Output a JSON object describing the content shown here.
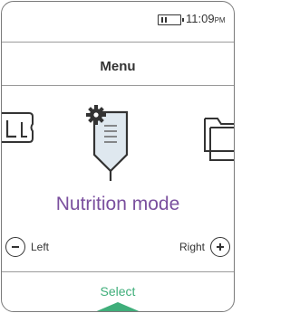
{
  "status": {
    "time": "11:09",
    "ampm": "PM",
    "battery_icon": "battery-icon"
  },
  "menu": {
    "title": "Menu"
  },
  "carousel": {
    "items": [
      {
        "icon": "timeline-icon"
      },
      {
        "icon": "nutrition-bag-icon"
      },
      {
        "icon": "folder-icon"
      }
    ],
    "selected_label": "Nutrition mode"
  },
  "nav": {
    "left_label": "Left",
    "right_label": "Right"
  },
  "action": {
    "select_label": "Select"
  },
  "colors": {
    "accent_purple": "#7a4f9e",
    "accent_green": "#3fae7a"
  }
}
